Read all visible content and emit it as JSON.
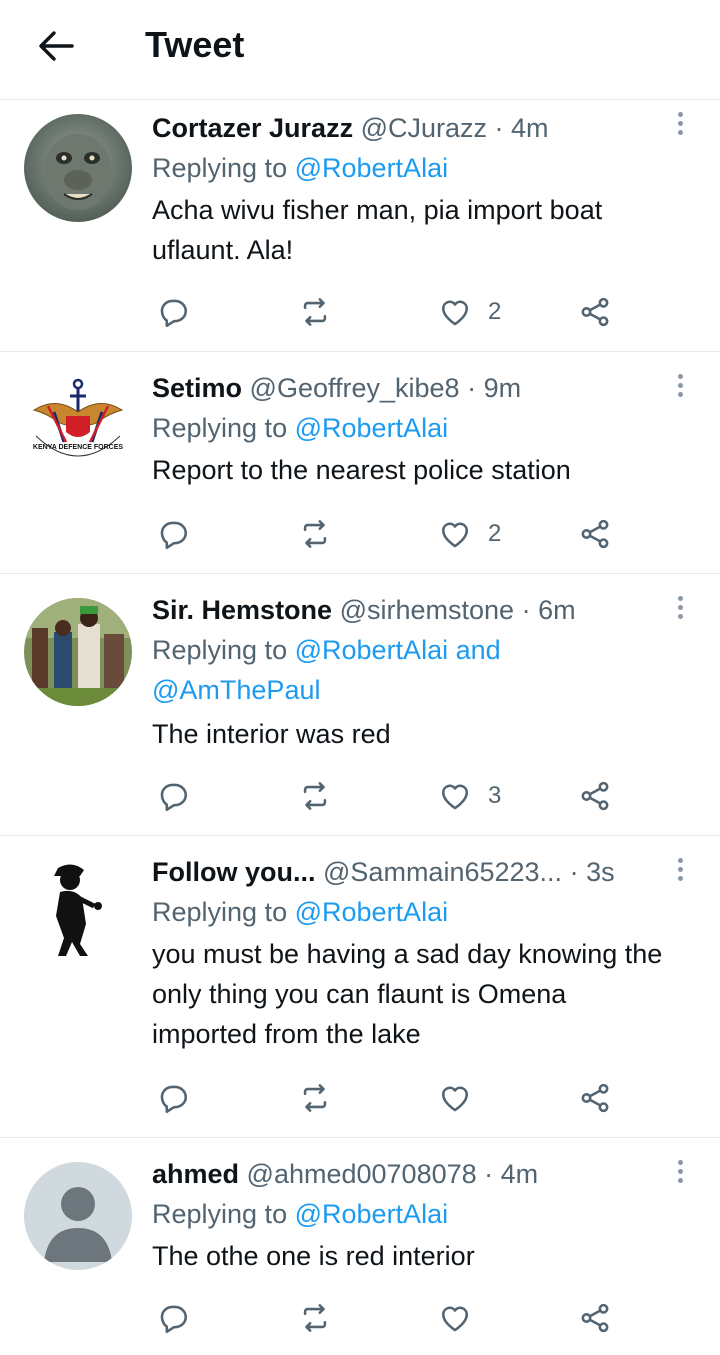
{
  "header": {
    "title": "Tweet",
    "back_icon": "arrow-left-icon"
  },
  "colors": {
    "link": "#1d9bf0",
    "secondary": "#536471",
    "divider": "#e6e9ec",
    "icon": "#536471"
  },
  "tweets": [
    {
      "name": "Cortazer Jurazz",
      "handle": "@CJurazz",
      "time": "· 4m",
      "replying_prefix": "Replying to",
      "mentions": "@RobertAlai",
      "mentions2": "",
      "text": "Acha wivu fisher man, pia import boat uflaunt. Ala!",
      "likes": "2"
    },
    {
      "name": "Setimo",
      "handle": "@Geoffrey_kibe8",
      "time": "· 9m",
      "replying_prefix": "Replying to",
      "mentions": "@RobertAlai",
      "mentions2": "",
      "text": "Report to the nearest police station",
      "likes": "2"
    },
    {
      "name": "Sir. Hemstone",
      "handle": "@sirhemstone",
      "time": "· 6m",
      "replying_prefix": "Replying to",
      "mentions": "@RobertAlai and",
      "mentions2": "@AmThePaul",
      "text": "The interior was red",
      "likes": "3"
    },
    {
      "name": "Follow you...",
      "handle": "@Sammain65223...",
      "time": "· 3s",
      "replying_prefix": "Replying to",
      "mentions": "@RobertAlai",
      "mentions2": "",
      "text": "you must be having a sad day knowing the only thing you can flaunt is Omena imported from the lake",
      "likes": ""
    },
    {
      "name": "ahmed",
      "handle": "@ahmed00708078",
      "time": "· 4m",
      "replying_prefix": "Replying to",
      "mentions": "@RobertAlai",
      "mentions2": "",
      "text": "The othe one is red interior",
      "likes": ""
    }
  ],
  "avatar_logo_text": {
    "left": "KENYA",
    "bottom": "DEFENCE",
    "right": "FORCES"
  }
}
